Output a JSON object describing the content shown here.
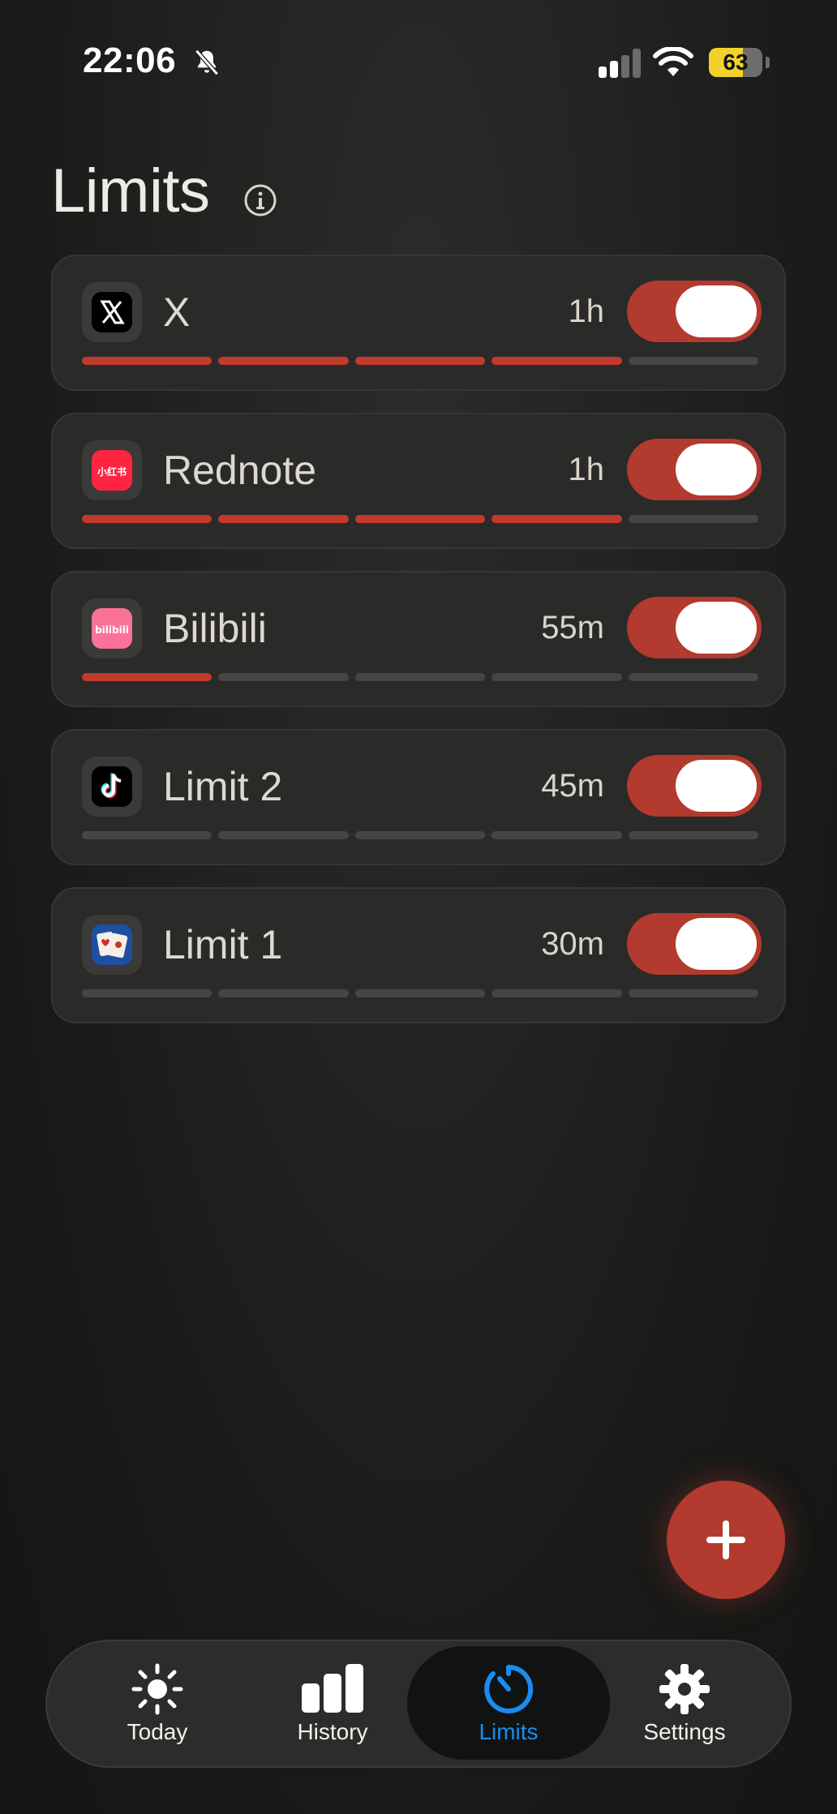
{
  "status_bar": {
    "time": "22:06",
    "battery": "63",
    "battery_level": 0.63,
    "icons": [
      "bell-slash-icon",
      "cellular-signal-icon",
      "wifi-icon",
      "battery-icon"
    ]
  },
  "page": {
    "title": "Limits",
    "info_icon": "info-icon"
  },
  "limits": [
    {
      "name": "X",
      "time": "1h",
      "enabled": true,
      "segments_used": 4,
      "segments_total": 5,
      "icon": "x-app-icon"
    },
    {
      "name": "Rednote",
      "time": "1h",
      "enabled": true,
      "segments_used": 4,
      "segments_total": 5,
      "icon": "rednote-app-icon",
      "icon_text": "小红书"
    },
    {
      "name": "Bilibili",
      "time": "55m",
      "enabled": true,
      "segments_used": 1,
      "segments_total": 5,
      "icon": "bilibili-app-icon",
      "icon_text": "bilibili"
    },
    {
      "name": "Limit 2",
      "time": "45m",
      "enabled": true,
      "segments_used": 0,
      "segments_total": 5,
      "icon": "tiktok-app-icon"
    },
    {
      "name": "Limit 1",
      "time": "30m",
      "enabled": true,
      "segments_used": 0,
      "segments_total": 5,
      "icon": "cards-game-app-icon"
    }
  ],
  "fab": {
    "icon": "plus-icon"
  },
  "tabs": [
    {
      "label": "Today",
      "icon": "sun-icon",
      "active": false
    },
    {
      "label": "History",
      "icon": "bar-chart-icon",
      "active": false
    },
    {
      "label": "Limits",
      "icon": "timer-icon",
      "active": true
    },
    {
      "label": "Settings",
      "icon": "gear-icon",
      "active": false
    }
  ],
  "colors": {
    "accent_red": "#b23a2e",
    "active_tab_blue": "#1a8cf0"
  }
}
